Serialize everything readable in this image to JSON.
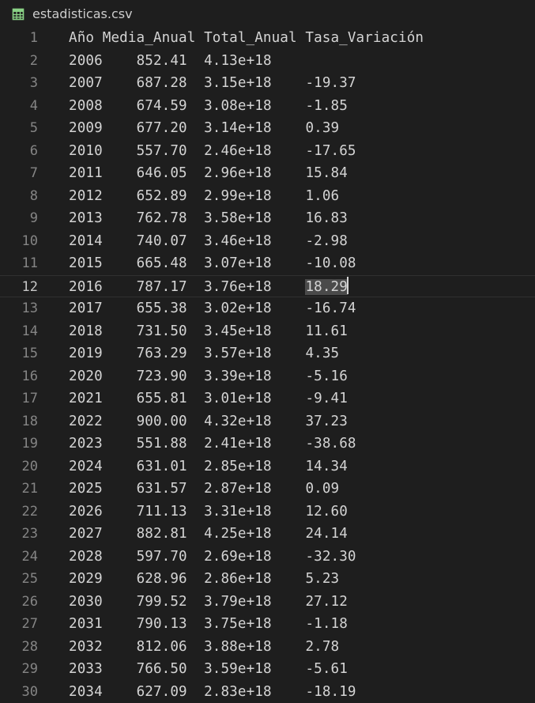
{
  "tab": {
    "file_icon": "csv-table-icon",
    "title": "estadisticas.csv"
  },
  "colors": {
    "background": "#1e1e1e",
    "text": "#d4d4d4",
    "line_number": "#858585",
    "icon_green": "#89d185",
    "selection": "#4a4a4a"
  },
  "editor": {
    "current_line": "12",
    "header": {
      "number": "1",
      "text": "Año Media_Anual Total_Anual Tasa_Variación"
    },
    "rows": [
      {
        "number": "2",
        "year": "2006",
        "media": "852.41",
        "total": "4.13e+18",
        "tasa": ""
      },
      {
        "number": "3",
        "year": "2007",
        "media": "687.28",
        "total": "3.15e+18",
        "tasa": "-19.37"
      },
      {
        "number": "4",
        "year": "2008",
        "media": "674.59",
        "total": "3.08e+18",
        "tasa": "-1.85"
      },
      {
        "number": "5",
        "year": "2009",
        "media": "677.20",
        "total": "3.14e+18",
        "tasa": "0.39"
      },
      {
        "number": "6",
        "year": "2010",
        "media": "557.70",
        "total": "2.46e+18",
        "tasa": "-17.65"
      },
      {
        "number": "7",
        "year": "2011",
        "media": "646.05",
        "total": "2.96e+18",
        "tasa": "15.84"
      },
      {
        "number": "8",
        "year": "2012",
        "media": "652.89",
        "total": "2.99e+18",
        "tasa": "1.06"
      },
      {
        "number": "9",
        "year": "2013",
        "media": "762.78",
        "total": "3.58e+18",
        "tasa": "16.83"
      },
      {
        "number": "10",
        "year": "2014",
        "media": "740.07",
        "total": "3.46e+18",
        "tasa": "-2.98"
      },
      {
        "number": "11",
        "year": "2015",
        "media": "665.48",
        "total": "3.07e+18",
        "tasa": "-10.08"
      },
      {
        "number": "12",
        "year": "2016",
        "media": "787.17",
        "total": "3.76e+18",
        "tasa": "18.29"
      },
      {
        "number": "13",
        "year": "2017",
        "media": "655.38",
        "total": "3.02e+18",
        "tasa": "-16.74"
      },
      {
        "number": "14",
        "year": "2018",
        "media": "731.50",
        "total": "3.45e+18",
        "tasa": "11.61"
      },
      {
        "number": "15",
        "year": "2019",
        "media": "763.29",
        "total": "3.57e+18",
        "tasa": "4.35"
      },
      {
        "number": "16",
        "year": "2020",
        "media": "723.90",
        "total": "3.39e+18",
        "tasa": "-5.16"
      },
      {
        "number": "17",
        "year": "2021",
        "media": "655.81",
        "total": "3.01e+18",
        "tasa": "-9.41"
      },
      {
        "number": "18",
        "year": "2022",
        "media": "900.00",
        "total": "4.32e+18",
        "tasa": "37.23"
      },
      {
        "number": "19",
        "year": "2023",
        "media": "551.88",
        "total": "2.41e+18",
        "tasa": "-38.68"
      },
      {
        "number": "20",
        "year": "2024",
        "media": "631.01",
        "total": "2.85e+18",
        "tasa": "14.34"
      },
      {
        "number": "21",
        "year": "2025",
        "media": "631.57",
        "total": "2.87e+18",
        "tasa": "0.09"
      },
      {
        "number": "22",
        "year": "2026",
        "media": "711.13",
        "total": "3.31e+18",
        "tasa": "12.60"
      },
      {
        "number": "23",
        "year": "2027",
        "media": "882.81",
        "total": "4.25e+18",
        "tasa": "24.14"
      },
      {
        "number": "24",
        "year": "2028",
        "media": "597.70",
        "total": "2.69e+18",
        "tasa": "-32.30"
      },
      {
        "number": "25",
        "year": "2029",
        "media": "628.96",
        "total": "2.86e+18",
        "tasa": "5.23"
      },
      {
        "number": "26",
        "year": "2030",
        "media": "799.52",
        "total": "3.79e+18",
        "tasa": "27.12"
      },
      {
        "number": "27",
        "year": "2031",
        "media": "790.13",
        "total": "3.75e+18",
        "tasa": "-1.18"
      },
      {
        "number": "28",
        "year": "2032",
        "media": "812.06",
        "total": "3.88e+18",
        "tasa": "2.78"
      },
      {
        "number": "29",
        "year": "2033",
        "media": "766.50",
        "total": "3.59e+18",
        "tasa": "-5.61"
      },
      {
        "number": "30",
        "year": "2034",
        "media": "627.09",
        "total": "2.83e+18",
        "tasa": "-18.19"
      }
    ]
  }
}
